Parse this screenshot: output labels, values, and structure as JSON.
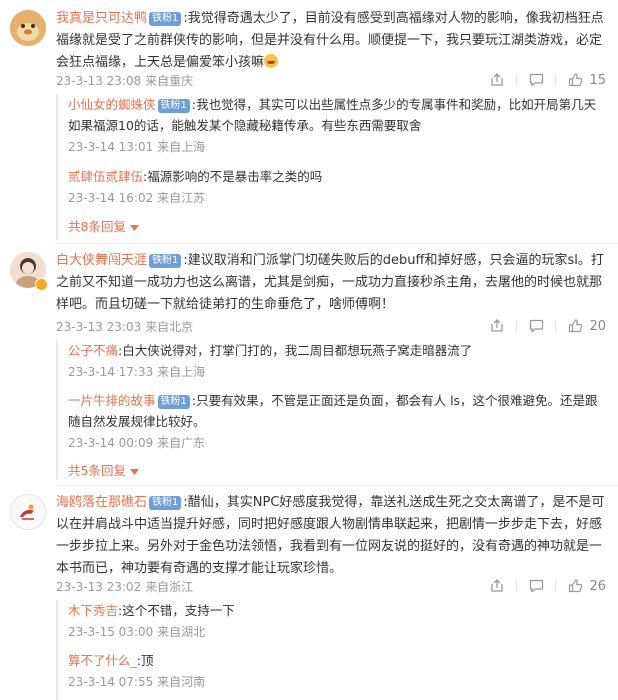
{
  "comments": [
    {
      "username": "我真是只可达鸭",
      "badge": "铁粉1",
      "text": ":我觉得奇遇太少了，目前没有感受到高福缘对人物的影响，像我初档狂点福缘就是受了之前群侠传的影响，但是并没有什么用。顺便提一下，我只要玩江湖类游戏，必定会狂点福缘，上天总是偏爱笨小孩嘛",
      "emoji": "shy-emoji",
      "time": "23-3-13 23:08",
      "location": "来自重庆",
      "likes": "15",
      "replies": [
        {
          "name": "小仙女的蜘蛛侠",
          "badge": "铁粉1",
          "text": ":我也觉得，其实可以出些属性点多少的专属事件和奖励，比如开局第几天如果福源10的话，能触发某个隐藏秘籍传承。有些东西需要取舍",
          "time": "23-3-14 13:01",
          "location": "来自上海"
        },
        {
          "name": "贰肆伍贰肆伍",
          "text": ":福源影响的不是暴击率之类的吗",
          "time": "23-3-14 16:02",
          "location": "来自江苏"
        }
      ],
      "more": "共8条回复"
    },
    {
      "username": "白大侠舞闯天涯",
      "badge": "铁粉1",
      "text": ":建议取消和门派掌门切磋失败后的debuff和掉好感，只会逼的玩家sl。打之前又不知道一成功力也这么离谱，尤其是剑痴，一成功力直接秒杀主角，去屠他的时候也就那样吧。而且切磋一下就给徒弟打的生命垂危了，啥师傅啊！",
      "time": "23-3-13 23:03",
      "location": "来自北京",
      "likes": "20",
      "replies": [
        {
          "name": "公子不痛",
          "text": ":白大侠说得对，打掌门打的，我二周目都想玩燕子窝走暗器流了",
          "time": "23-3-14 17:33",
          "location": "来自上海"
        },
        {
          "name": "一片牛排的故事",
          "badge": "铁粉1",
          "text": ":只要有效果，不管是正面还是负面，都会有人 ls，这个很难避免。还是跟随自然发展规律比较好。",
          "time": "23-3-14 00:09",
          "location": "来自广东"
        }
      ],
      "more": "共5条回复"
    },
    {
      "username": "海鸥落在那礁石",
      "badge": "铁粉1",
      "text": ":醋仙，其实NPC好感度我觉得，靠送礼送成生死之交太离谱了，是不是可以在并肩战斗中适当提升好感，同时把好感度跟人物剧情串联起来，把剧情一步步走下去，好感一步步拉上来。另外对于金色功法领悟，我看到有一位网友说的挺好的，没有奇遇的神功就是一本书而已，神功要有奇遇的支撑才能让玩家珍惜。",
      "time": "23-3-13 23:02",
      "location": "来自浙江",
      "likes": "26",
      "replies": [
        {
          "name": "木下秀吉",
          "text": ":这个不错，支持一下",
          "time": "23-3-15 03:00",
          "location": "来自湖北"
        },
        {
          "name": "算不了什么_",
          "text": ":顶",
          "time": "23-3-14 07:55",
          "location": "来自河南"
        }
      ]
    }
  ],
  "icons": {
    "share": "share-icon",
    "comment": "comment-icon",
    "like": "like-icon",
    "more_arrow": "chevron-down-icon"
  },
  "colors": {
    "username": "#eb7350",
    "badge": "#6f9fd8",
    "meta": "#999999"
  }
}
